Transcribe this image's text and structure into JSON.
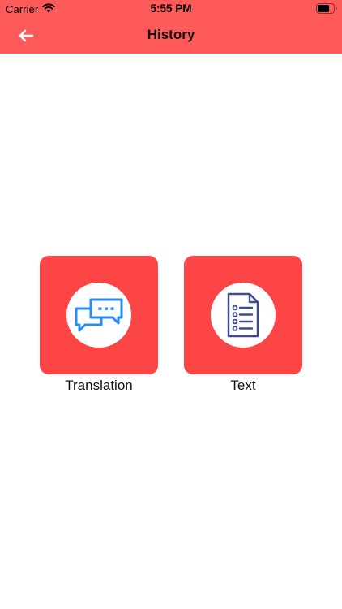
{
  "status_bar": {
    "carrier": "Carrier",
    "time": "5:55 PM",
    "wifi_icon": "wifi-icon",
    "battery_icon": "battery-icon"
  },
  "nav": {
    "title": "History",
    "back_icon": "back-arrow-icon"
  },
  "options": [
    {
      "label": "Translation",
      "icon": "chat-bubbles-icon"
    },
    {
      "label": "Text",
      "icon": "document-list-icon"
    }
  ],
  "colors": {
    "header": "#fe5a5a",
    "tile": "#fe4545",
    "chat_icon": "#2a8cf0",
    "document_icon": "#3d4a8e"
  }
}
